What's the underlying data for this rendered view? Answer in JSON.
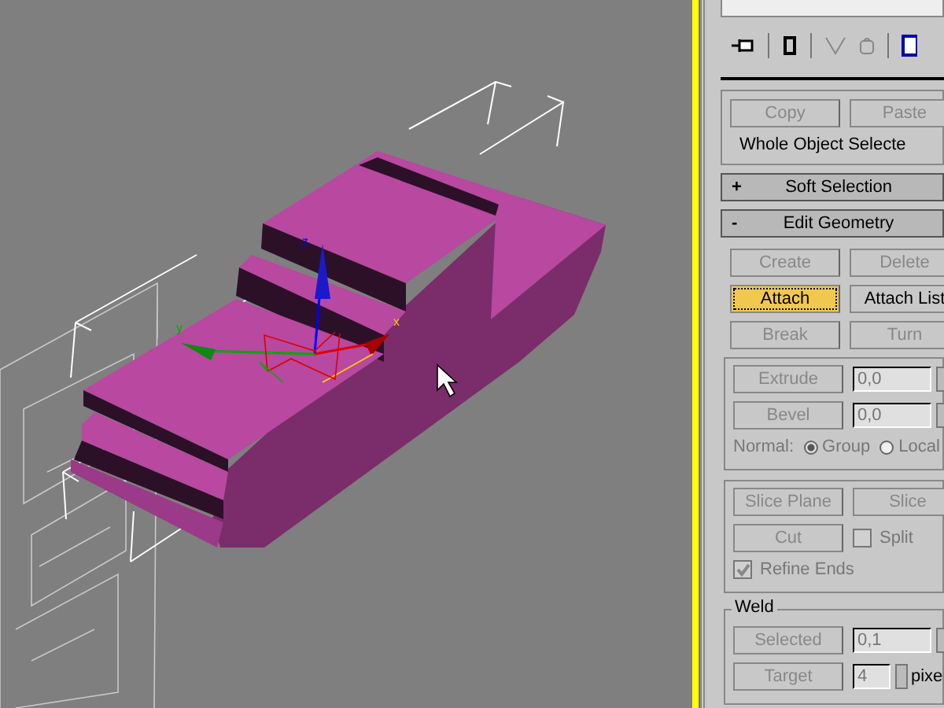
{
  "viewport": {
    "gizmo_labels": [
      "z",
      "y",
      "x"
    ]
  },
  "selection_rollout": {
    "buttons": [
      {
        "label": "Copy",
        "disabled": true
      },
      {
        "label": "Paste",
        "disabled": true
      }
    ],
    "status": "Whole Object Selecte"
  },
  "rollouts": [
    {
      "sign": "+",
      "label": "Soft Selection"
    },
    {
      "sign": "-",
      "label": "Edit Geometry"
    }
  ],
  "edit_geometry": {
    "button_rows": [
      [
        {
          "label": "Create",
          "disabled": true,
          "selected": false
        },
        {
          "label": "Delete",
          "disabled": true,
          "selected": false
        }
      ],
      [
        {
          "label": "Attach",
          "disabled": false,
          "selected": true
        },
        {
          "label": "Attach List",
          "disabled": false,
          "selected": false
        }
      ],
      [
        {
          "label": "Break",
          "disabled": true,
          "selected": false
        },
        {
          "label": "Turn",
          "disabled": true,
          "selected": false
        }
      ]
    ],
    "value_rows": [
      {
        "label": "Extrude",
        "value": "0,0",
        "disabled": true
      },
      {
        "label": "Bevel",
        "value": "0,0",
        "disabled": true
      }
    ],
    "normal": {
      "label": "Normal:",
      "disabled": true,
      "options": [
        {
          "label": "Group",
          "selected": true
        },
        {
          "label": "Local",
          "selected": false
        }
      ]
    },
    "slice_row": [
      {
        "label": "Slice Plane",
        "disabled": true
      },
      {
        "label": "Slice",
        "disabled": true
      }
    ],
    "cut": {
      "label": "Cut",
      "disabled": true
    },
    "split": {
      "label": "Split",
      "checked": false,
      "disabled": true
    },
    "refine_ends": {
      "label": "Refine Ends",
      "checked": true,
      "disabled": true
    }
  },
  "weld": {
    "title": "Weld",
    "rows": [
      {
        "button": "Selected",
        "value": "0,1",
        "disabled": true
      },
      {
        "button": "Target",
        "value": "4",
        "unit": "pixe",
        "disabled": true
      }
    ]
  }
}
